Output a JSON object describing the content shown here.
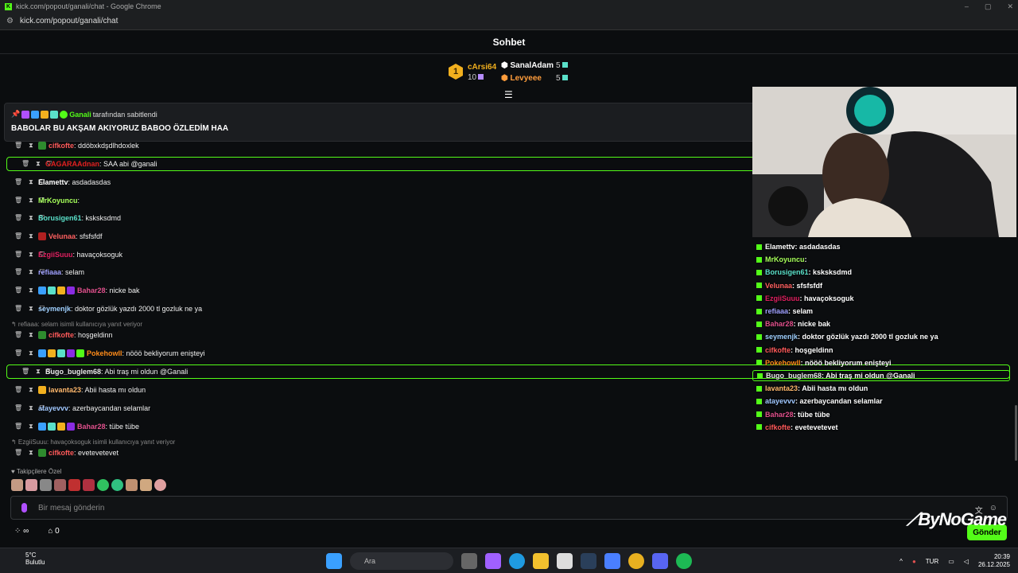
{
  "window": {
    "title": "kick.com/popout/ganali/chat - Google Chrome",
    "url": "kick.com/popout/ganali/chat"
  },
  "chat": {
    "title": "Sohbet"
  },
  "leaderboard": {
    "first": {
      "rank": "1",
      "name": "cArsi64",
      "count": "10"
    },
    "second": {
      "name": "SanalAdam",
      "count": "5"
    },
    "third": {
      "name": "Levyeee",
      "count": "5"
    }
  },
  "pinned": {
    "by_user": "Ganali",
    "by_suffix": "tarafından sabitlendi",
    "message": "BABOLAR BU AKŞAM AKIYORUZ BABOO ÖZLEDİM HAA"
  },
  "messages": [
    {
      "user": "cifkofte",
      "color": "#ff5a5a",
      "text": ": ddöbxkdşdlhdoxlek"
    },
    {
      "user": "GAGARAAdnan",
      "color": "#e02020",
      "text": ": SAA abi @ganali"
    },
    {
      "user": "Elamettv",
      "color": "#ffffff",
      "text": ": asdadasdas"
    },
    {
      "user": "MrKoyuncu",
      "color": "#a6ff5a",
      "text": ":"
    },
    {
      "user": "Borusigen61",
      "color": "#5ae0c9",
      "text": ": ksksksdmd"
    },
    {
      "user": "Velunaa",
      "color": "#ff6060",
      "text": ": sfsfsfdf"
    },
    {
      "user": "EzgiiSuuu",
      "color": "#e02060",
      "text": ": havaçoksoguk"
    },
    {
      "user": "refiaaa",
      "color": "#9fa0ff",
      "text": ": selam"
    },
    {
      "user": "Bahar28",
      "color": "#e0508c",
      "text": ": nicke bak"
    },
    {
      "user": "seymenjk",
      "color": "#9fd0ff",
      "text": ": doktor gözlük yazdı 2000 tl gozluk ne ya"
    },
    {
      "user": "cifkofte",
      "color": "#ff5a5a",
      "text": ": hoşgeldinn"
    },
    {
      "user": "Pokehowll",
      "color": "#ff8c1a",
      "text": ": nööö bekliyorum enişteyi"
    },
    {
      "user": "Bugo_buglem68",
      "color": "#e8e8e8",
      "text": ": Abi traş mi oldun @Ganali"
    },
    {
      "user": "lavanta23",
      "color": "#ffb86c",
      "text": ": Abii hasta mı oldun"
    },
    {
      "user": "atayevvv",
      "color": "#a0c8ff",
      "text": ": azerbaycandan selamlar"
    },
    {
      "user": "Bahar28",
      "color": "#e0508c",
      "text": ": tübe tübe"
    },
    {
      "user": "cifkofte",
      "color": "#ff5a5a",
      "text": ": evetevetevet"
    }
  ],
  "replies": [
    "refiaaa: selam isimli kullanıcıya yanıt veriyor",
    "EzgiiSuuu: havaçoksoguk isimli kullanıcıya yanıt veriyor"
  ],
  "followers_label": "Takipçilere Özel",
  "input": {
    "placeholder": "Bir mesaj gönderin"
  },
  "bottom": {
    "infinity": "∞",
    "store_count": "0",
    "send_label": "Gönder"
  },
  "overlay_messages": [
    {
      "user": "Elamettv",
      "color": "#ffffff",
      "text": " : asdadasdas"
    },
    {
      "user": "MrKoyuncu",
      "color": "#a6ff5a",
      "text": " :"
    },
    {
      "user": "Borusigen61",
      "color": "#5ae0c9",
      "text": " : ksksksdmd"
    },
    {
      "user": "Velunaa",
      "color": "#ff6060",
      "text": " : sfsfsfdf"
    },
    {
      "user": "EzgiiSuuu",
      "color": "#e02060",
      "text": " : havaçoksoguk"
    },
    {
      "user": "refiaaa",
      "color": "#9fa0ff",
      "text": " : selam"
    },
    {
      "user": "Bahar28",
      "color": "#e0508c",
      "text": " : nicke bak"
    },
    {
      "user": "seymenjk",
      "color": "#9fd0ff",
      "text": " : doktor gözlük yazdı 2000 tl gozluk ne ya"
    },
    {
      "user": "cifkofte",
      "color": "#ff5a5a",
      "text": " : hoşgeldinn"
    },
    {
      "user": "Pokehowll",
      "color": "#ff8c1a",
      "text": " : nööö bekliyorum enişteyi"
    },
    {
      "user": "Bugo_buglem68",
      "color": "#e8e8e8",
      "text": " : Abi traş mi oldun @Ganali"
    },
    {
      "user": "lavanta23",
      "color": "#ffb86c",
      "text": " : Abii hasta mı oldun"
    },
    {
      "user": "atayevvv",
      "color": "#a0c8ff",
      "text": " : azerbaycandan selamlar"
    },
    {
      "user": "Bahar28",
      "color": "#e0508c",
      "text": " : tübe tübe"
    },
    {
      "user": "cifkofte",
      "color": "#ff5a5a",
      "text": " : evetevetevet"
    }
  ],
  "watermark": "ByNoGame",
  "taskbar": {
    "weather_temp": "5°C",
    "weather_desc": "Bulutlu",
    "search_label": "Ara",
    "lang": "TUR",
    "time": "20:39",
    "date": "26.12.2025"
  },
  "colors": {
    "accent": "#53fc18",
    "background": "#0b0d0f"
  }
}
